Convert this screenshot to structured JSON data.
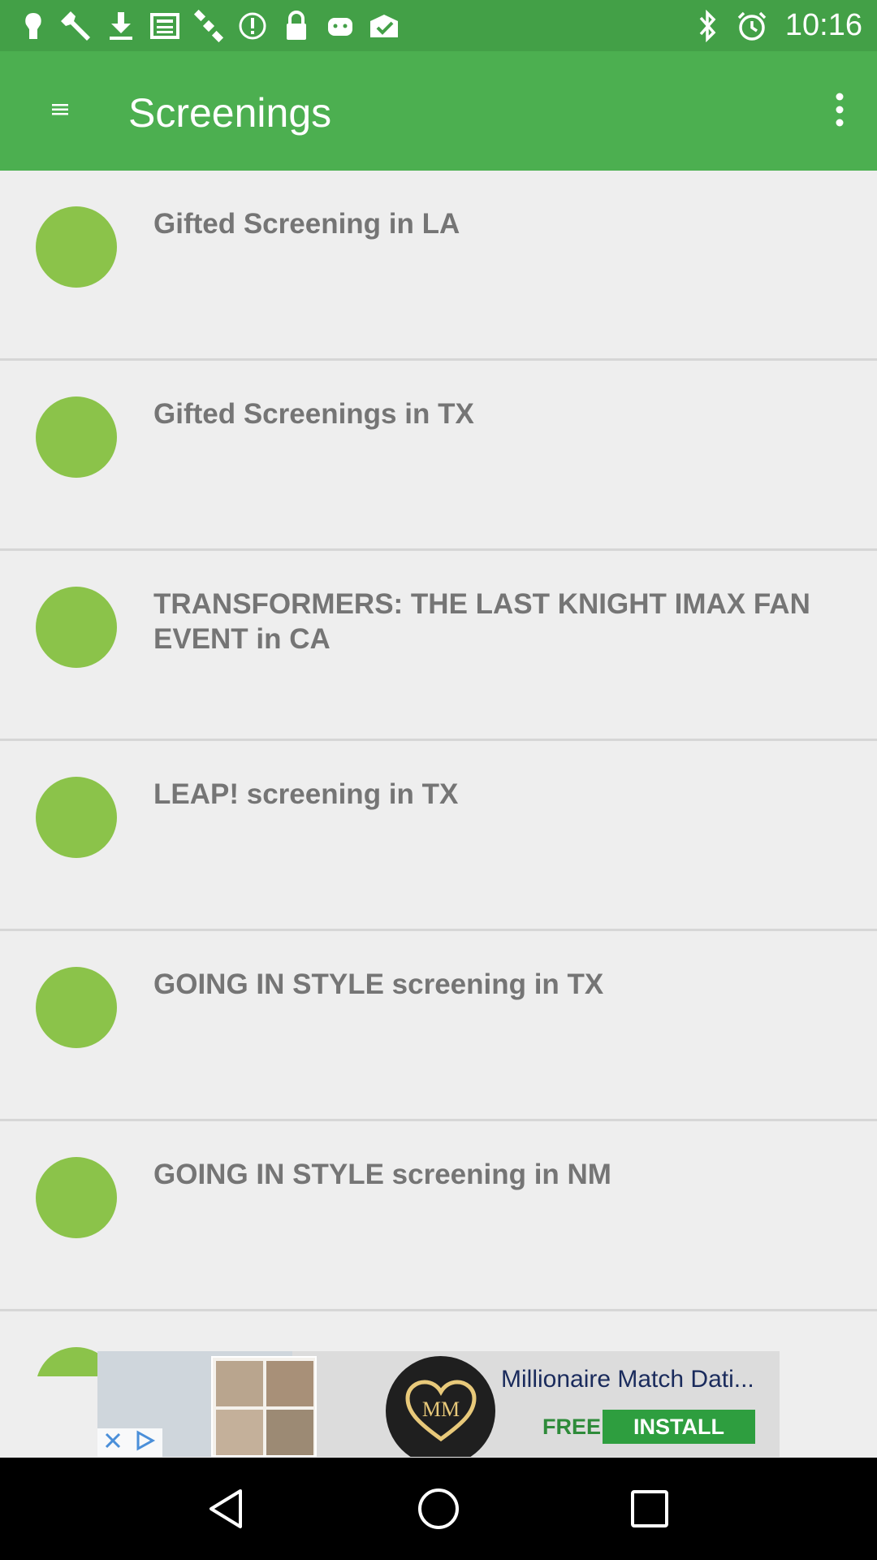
{
  "statusbar": {
    "time": "10:16",
    "left_icons": [
      "notification-icon",
      "wrench-icon",
      "download-icon",
      "news-icon",
      "satellite-icon",
      "alert-circle-icon",
      "lock-icon",
      "android-icon",
      "mail-check-icon"
    ],
    "right_icons": [
      "bluetooth-icon",
      "alarm-icon"
    ]
  },
  "appbar": {
    "title": "Screenings",
    "color": "#4caf50"
  },
  "screenings": [
    {
      "title": "Gifted Screening in LA"
    },
    {
      "title": "Gifted Screenings in TX"
    },
    {
      "title": "TRANSFORMERS: THE LAST KNIGHT IMAX FAN EVENT in CA"
    },
    {
      "title": "LEAP! screening in TX"
    },
    {
      "title": "GOING IN STYLE screening in TX"
    },
    {
      "title": "GOING IN STYLE screening in NM"
    }
  ],
  "ad": {
    "title": "Millionaire Match Dati...",
    "free_label": "FREE",
    "install_label": "INSTALL"
  },
  "navbar": {
    "buttons": [
      "back-icon",
      "home-icon",
      "recents-icon"
    ]
  },
  "colors": {
    "accent": "#8bc34a",
    "statusbar": "#43a047"
  }
}
